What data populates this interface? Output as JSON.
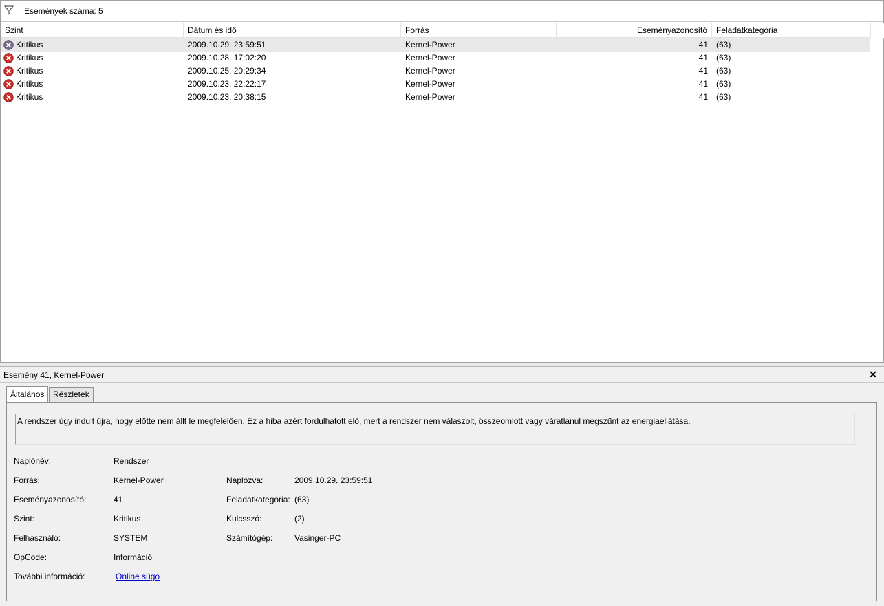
{
  "filter_bar": {
    "icon": "filter-icon",
    "text": "Események száma: 5"
  },
  "grid": {
    "columns": [
      "Szint",
      "Dátum és idő",
      "Forrás",
      "Eseményazonosító",
      "Feladatkategória"
    ],
    "rows": [
      {
        "level": "Kritikus",
        "datetime": "2009.10.29. 23:59:51",
        "source": "Kernel-Power",
        "event_id": "41",
        "task_category": "(63)"
      },
      {
        "level": "Kritikus",
        "datetime": "2009.10.28. 17:02:20",
        "source": "Kernel-Power",
        "event_id": "41",
        "task_category": "(63)"
      },
      {
        "level": "Kritikus",
        "datetime": "2009.10.25. 20:29:34",
        "source": "Kernel-Power",
        "event_id": "41",
        "task_category": "(63)"
      },
      {
        "level": "Kritikus",
        "datetime": "2009.10.23. 22:22:17",
        "source": "Kernel-Power",
        "event_id": "41",
        "task_category": "(63)"
      },
      {
        "level": "Kritikus",
        "datetime": "2009.10.23. 20:38:15",
        "source": "Kernel-Power",
        "event_id": "41",
        "task_category": "(63)"
      }
    ]
  },
  "detail": {
    "title": "Esemény 41, Kernel-Power",
    "close_icon": "close-icon",
    "tabs": [
      "Általános",
      "Részletek"
    ],
    "description": "A rendszer úgy indult újra, hogy előtte nem állt le megfelelően. Ez a hiba azért fordulhatott elő, mert a rendszer nem válaszolt, összeomlott vagy váratlanul megszűnt az energiaellátása.",
    "props": {
      "log_name_label": "Naplónév:",
      "log_name": "Rendszer",
      "source_label": "Forrás:",
      "source": "Kernel-Power",
      "logged_label": "Naplózva:",
      "logged": "2009.10.29. 23:59:51",
      "event_id_label": "Eseményazonosító:",
      "event_id": "41",
      "task_category_label": "Feladatkategória:",
      "task_category": "(63)",
      "level_label": "Szint:",
      "level": "Kritikus",
      "keywords_label": "Kulcsszó:",
      "keywords": "(2)",
      "user_label": "Felhasználó:",
      "user": "SYSTEM",
      "computer_label": "Számítógép:",
      "computer": "Vasinger-PC",
      "opcode_label": "OpCode:",
      "opcode": "Információ",
      "more_info_label": "További információ:",
      "more_info_link": "Online súgó"
    }
  },
  "colors": {
    "error_icon": "#c8312b",
    "selected_row": "#e8e8e8",
    "pane_bg": "#f0f0f0",
    "link": "#0000cc"
  }
}
